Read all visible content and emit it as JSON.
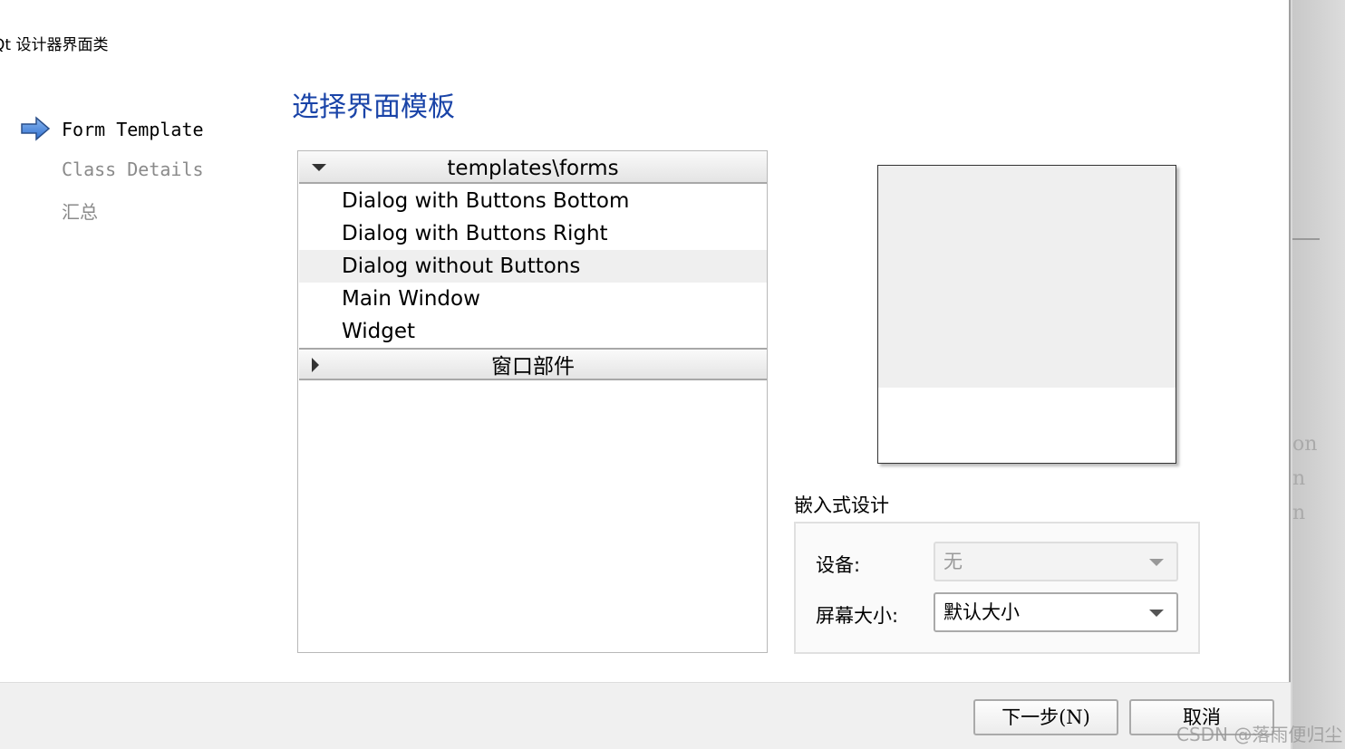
{
  "window": {
    "title": "Qt 设计器界面类"
  },
  "steps": [
    {
      "label": "Form Template",
      "active": true
    },
    {
      "label": "Class Details",
      "active": false
    },
    {
      "label": "汇总",
      "active": false
    }
  ],
  "heading": "选择界面模板",
  "tree": {
    "groups": [
      {
        "label": "templates\\forms",
        "expanded": true,
        "items": [
          "Dialog with Buttons Bottom",
          "Dialog with Buttons Right",
          "Dialog without Buttons",
          "Main Window",
          "Widget"
        ],
        "selected": "Dialog without Buttons"
      },
      {
        "label": "窗口部件",
        "expanded": false
      }
    ]
  },
  "embedded": {
    "title": "嵌入式设计",
    "device_label": "设备:",
    "device_value": "无",
    "screen_label": "屏幕大小:",
    "screen_value": "默认大小"
  },
  "buttons": {
    "next": "下一步(N)",
    "cancel": "取消"
  },
  "background": {
    "texts": [
      "on",
      "n",
      "n"
    ]
  },
  "watermark": "CSDN @落雨便归尘",
  "colors": {
    "heading": "#1a44a8",
    "inactive_step": "#8a8a8a"
  }
}
